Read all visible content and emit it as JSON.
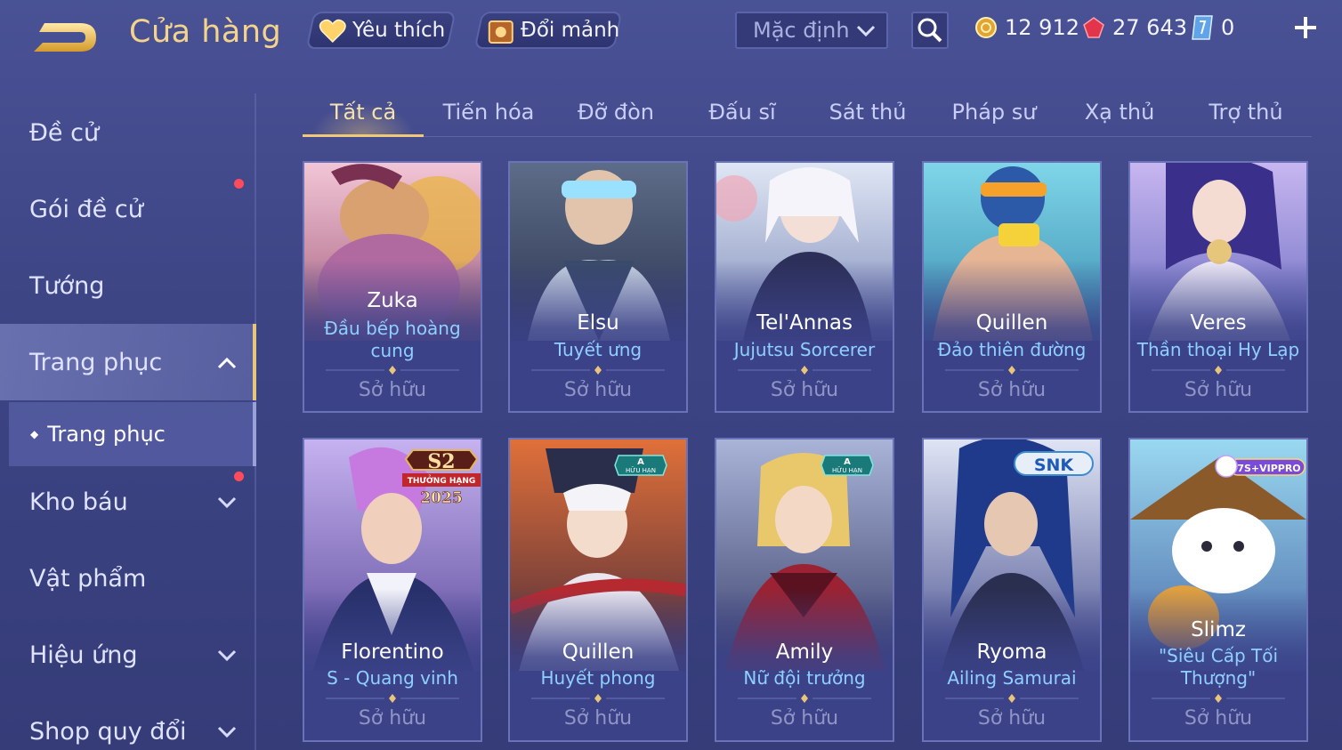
{
  "header": {
    "title": "Cửa hàng",
    "favorites_label": "Yêu thích",
    "shards_label": "Đổi mảnh",
    "sort_label": "Mặc định",
    "gold": "12 912",
    "rubies": "27 643",
    "vouchers": "0"
  },
  "sidebar": {
    "items": [
      {
        "label": "Đề cử"
      },
      {
        "label": "Gói đề cử"
      },
      {
        "label": "Tướng"
      },
      {
        "label": "Trang phục"
      },
      {
        "label": "Kho báu"
      },
      {
        "label": "Vật phẩm"
      },
      {
        "label": "Hiệu ứng"
      },
      {
        "label": "Shop quy đổi"
      }
    ],
    "sub_item": {
      "label": "Trang phục"
    }
  },
  "tabs": [
    {
      "label": "Tất cả"
    },
    {
      "label": "Tiến hóa"
    },
    {
      "label": "Đỡ đòn"
    },
    {
      "label": "Đấu sĩ"
    },
    {
      "label": "Sát thủ"
    },
    {
      "label": "Pháp sư"
    },
    {
      "label": "Xạ thủ"
    },
    {
      "label": "Trợ thủ"
    }
  ],
  "cards": [
    {
      "hero": "Zuka",
      "skin": "Đầu bếp hoàng cung",
      "status": "Sở hữu"
    },
    {
      "hero": "Elsu",
      "skin": "Tuyết ưng",
      "status": "Sở hữu"
    },
    {
      "hero": "Tel'Annas",
      "skin": "Jujutsu Sorcerer",
      "status": "Sở hữu"
    },
    {
      "hero": "Quillen",
      "skin": "Đảo thiên đường",
      "status": "Sở hữu"
    },
    {
      "hero": "Veres",
      "skin": "Thần thoại Hy Lạp",
      "status": "Sở hữu"
    },
    {
      "hero": "Florentino",
      "skin": "S - Quang vinh",
      "status": "Sở hữu",
      "badge_s2": "S2",
      "badge_s2_sub": "THƯỞNG HẠNG",
      "badge_s2_year": "2025"
    },
    {
      "hero": "Quillen",
      "skin": "Huyết phong",
      "status": "Sở hữu",
      "badge_a": "A",
      "badge_a_sub": "HỮU HẠN"
    },
    {
      "hero": "Amily",
      "skin": "Nữ đội trưởng",
      "status": "Sở hữu",
      "badge_a": "A",
      "badge_a_sub": "HỮU HẠN"
    },
    {
      "hero": "Ryoma",
      "skin": "Ailing Samurai",
      "status": "Sở hữu",
      "badge_snk": "SNK"
    },
    {
      "hero": "Slimz",
      "skin": "\"Siêu Cấp Tối Thượng\"",
      "status": "Sở hữu",
      "badge_vip": "7S+VIPPRO"
    }
  ],
  "colors": {
    "accent_gold": "#f3d48a",
    "skin_blue": "#8fd0ff",
    "badge_red": "#ff4b5c"
  }
}
